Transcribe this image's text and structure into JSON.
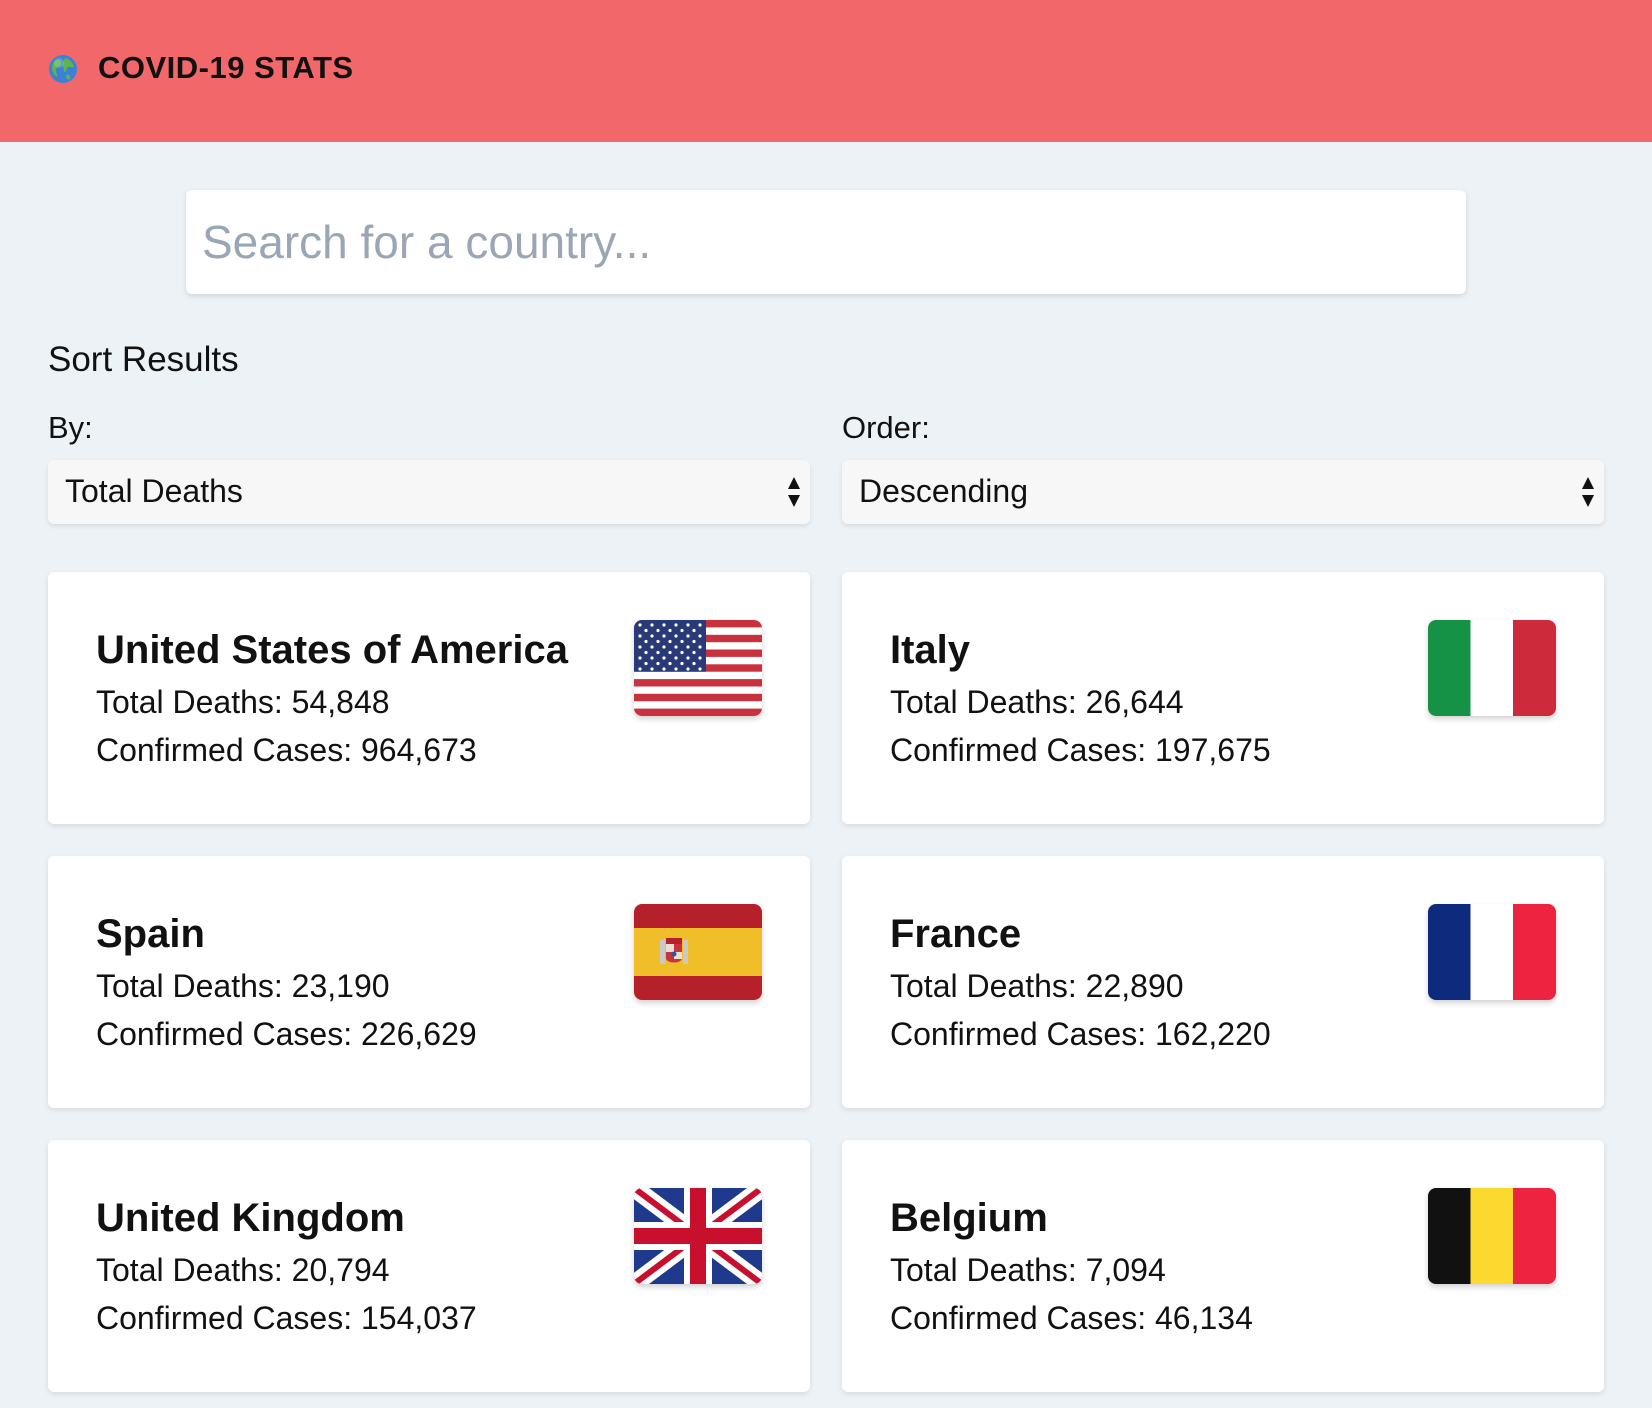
{
  "header": {
    "icon": "globe-icon",
    "title": "COVID-19 STATS",
    "background_color": "#f2676a"
  },
  "search": {
    "placeholder": "Search for a country..."
  },
  "sort": {
    "heading": "Sort Results",
    "by_label": "By:",
    "by_value": "Total Deaths",
    "order_label": "Order:",
    "order_value": "Descending"
  },
  "countries": [
    {
      "name": "United States of America",
      "deaths_label": "Total Deaths: 54,848",
      "cases_label": "Confirmed Cases: 964,673",
      "flag": "usa-flag-icon"
    },
    {
      "name": "Italy",
      "deaths_label": "Total Deaths: 26,644",
      "cases_label": "Confirmed Cases: 197,675",
      "flag": "italy-flag-icon"
    },
    {
      "name": "Spain",
      "deaths_label": "Total Deaths: 23,190",
      "cases_label": "Confirmed Cases: 226,629",
      "flag": "spain-flag-icon"
    },
    {
      "name": "France",
      "deaths_label": "Total Deaths: 22,890",
      "cases_label": "Confirmed Cases: 162,220",
      "flag": "france-flag-icon"
    },
    {
      "name": "United Kingdom",
      "deaths_label": "Total Deaths: 20,794",
      "cases_label": "Confirmed Cases: 154,037",
      "flag": "uk-flag-icon"
    },
    {
      "name": "Belgium",
      "deaths_label": "Total Deaths: 7,094",
      "cases_label": "Confirmed Cases: 46,134",
      "flag": "belgium-flag-icon"
    }
  ]
}
